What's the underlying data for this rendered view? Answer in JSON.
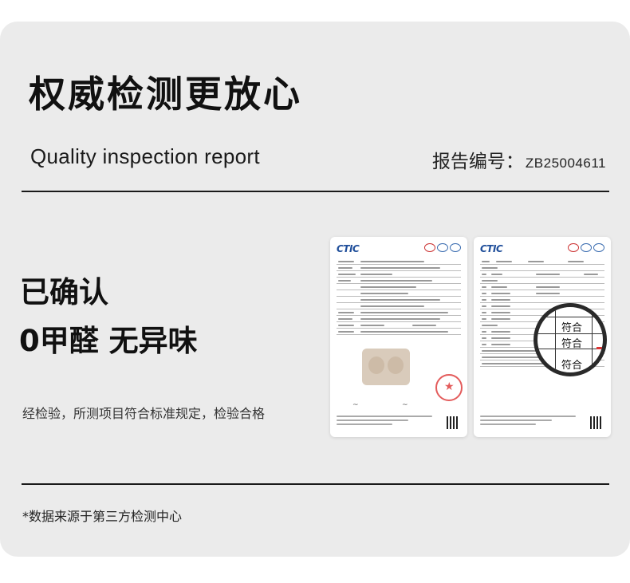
{
  "header": {
    "title": "权威检测更放心",
    "subtitle": "Quality inspection report",
    "report_no_label": "报告编号：",
    "report_no_value": "ZB25004611"
  },
  "claims": {
    "line1": "已确认",
    "line2": "0甲醛 无异味"
  },
  "description": "经检验，所测项目符合标准规定，检验合格",
  "footer_note": "*数据来源于第三方检测中心",
  "documents": {
    "logo": "CTIC",
    "magnifier_results": [
      "符合",
      "符合",
      "符合"
    ]
  }
}
